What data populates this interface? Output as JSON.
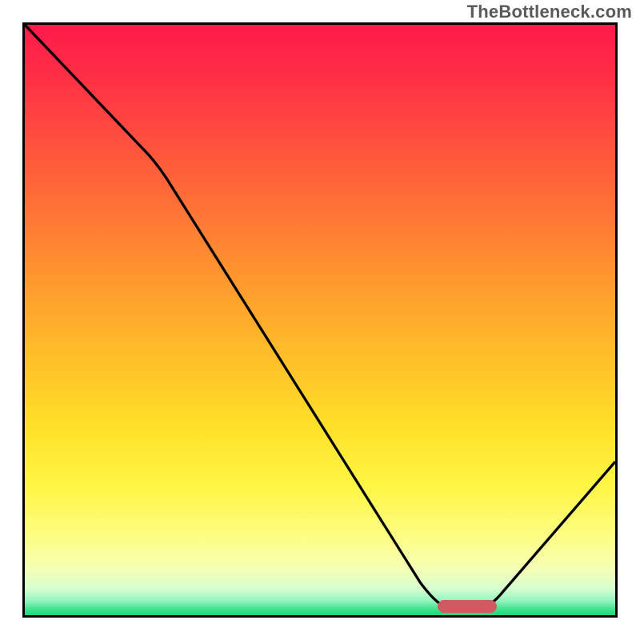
{
  "watermark": "TheBottleneck.com",
  "chart_data": {
    "type": "line",
    "title": "",
    "xlabel": "",
    "ylabel": "",
    "x_range": [
      0,
      100
    ],
    "y_range": [
      0,
      100
    ],
    "curve": [
      {
        "x": 0,
        "y": 100
      },
      {
        "x": 22,
        "y": 77
      },
      {
        "x": 70,
        "y": 1.5
      },
      {
        "x": 79,
        "y": 1.5
      },
      {
        "x": 100,
        "y": 26
      }
    ],
    "optimum_marker": {
      "x_start": 70,
      "x_end": 79,
      "y": 1.5
    },
    "gradient_stops": [
      {
        "offset": 0.0,
        "color": "#ff1a4b"
      },
      {
        "offset": 0.07,
        "color": "#ff2a46"
      },
      {
        "offset": 0.18,
        "color": "#ff4a3f"
      },
      {
        "offset": 0.3,
        "color": "#ff6f37"
      },
      {
        "offset": 0.42,
        "color": "#ff942f"
      },
      {
        "offset": 0.55,
        "color": "#ffbb29"
      },
      {
        "offset": 0.68,
        "color": "#ffe028"
      },
      {
        "offset": 0.78,
        "color": "#fff544"
      },
      {
        "offset": 0.86,
        "color": "#fdfd7e"
      },
      {
        "offset": 0.92,
        "color": "#f6ffb3"
      },
      {
        "offset": 0.955,
        "color": "#d6ffcf"
      },
      {
        "offset": 0.975,
        "color": "#96f4c0"
      },
      {
        "offset": 0.99,
        "color": "#3fe28f"
      },
      {
        "offset": 1.0,
        "color": "#18d977"
      }
    ]
  }
}
